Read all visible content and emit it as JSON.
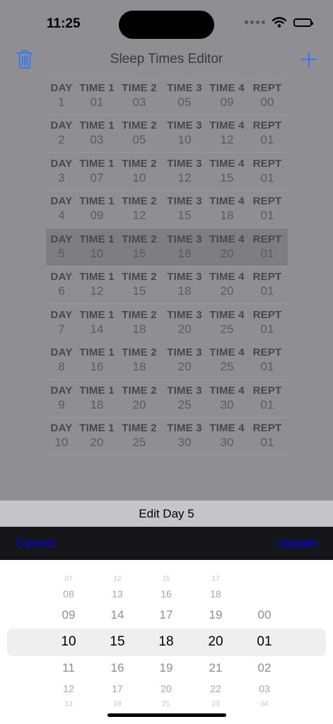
{
  "status_bar": {
    "time": "11:25"
  },
  "nav": {
    "title": "Sleep Times Editor"
  },
  "labels": [
    "DAY",
    "TIME 1",
    "TIME 2",
    "TIME 3",
    "TIME 4",
    "REPT"
  ],
  "rows": [
    {
      "day": "1",
      "t1": "01",
      "t2": "03",
      "t3": "05",
      "t4": "09",
      "rept": "00"
    },
    {
      "day": "2",
      "t1": "03",
      "t2": "05",
      "t3": "10",
      "t4": "12",
      "rept": "01"
    },
    {
      "day": "3",
      "t1": "07",
      "t2": "10",
      "t3": "12",
      "t4": "15",
      "rept": "01"
    },
    {
      "day": "4",
      "t1": "09",
      "t2": "12",
      "t3": "15",
      "t4": "18",
      "rept": "01"
    },
    {
      "day": "5",
      "t1": "10",
      "t2": "15",
      "t3": "18",
      "t4": "20",
      "rept": "01"
    },
    {
      "day": "6",
      "t1": "12",
      "t2": "15",
      "t3": "18",
      "t4": "20",
      "rept": "01"
    },
    {
      "day": "7",
      "t1": "14",
      "t2": "18",
      "t3": "20",
      "t4": "25",
      "rept": "01"
    },
    {
      "day": "8",
      "t1": "16",
      "t2": "18",
      "t3": "20",
      "t4": "25",
      "rept": "01"
    },
    {
      "day": "9",
      "t1": "18",
      "t2": "20",
      "t3": "25",
      "t4": "30",
      "rept": "01"
    },
    {
      "day": "10",
      "t1": "20",
      "t2": "25",
      "t3": "30",
      "t4": "30",
      "rept": "01"
    }
  ],
  "selected_row": 4,
  "edit_bar": {
    "title": "Edit Day 5"
  },
  "toolbar": {
    "cancel": "Cancel",
    "update": "Update"
  },
  "picker": {
    "columns": [
      [
        "07",
        "08",
        "09",
        "10",
        "11",
        "12",
        "13"
      ],
      [
        "12",
        "13",
        "14",
        "15",
        "16",
        "17",
        "18"
      ],
      [
        "15",
        "16",
        "17",
        "18",
        "19",
        "20",
        "21"
      ],
      [
        "17",
        "18",
        "19",
        "20",
        "21",
        "22",
        "23"
      ],
      [
        "",
        "",
        "00",
        "01",
        "02",
        "03",
        "04"
      ]
    ]
  },
  "colors": {
    "accent": "#3478f6",
    "toolbar_button": "#0000ee",
    "dim_overlay": "#8e8e93",
    "selected_row": "#7d7d82"
  },
  "icons": {
    "delete": "trash-icon",
    "add": "plus-icon",
    "signal": "cellular-signal-icon",
    "wifi": "wifi-icon",
    "battery": "battery-icon"
  }
}
